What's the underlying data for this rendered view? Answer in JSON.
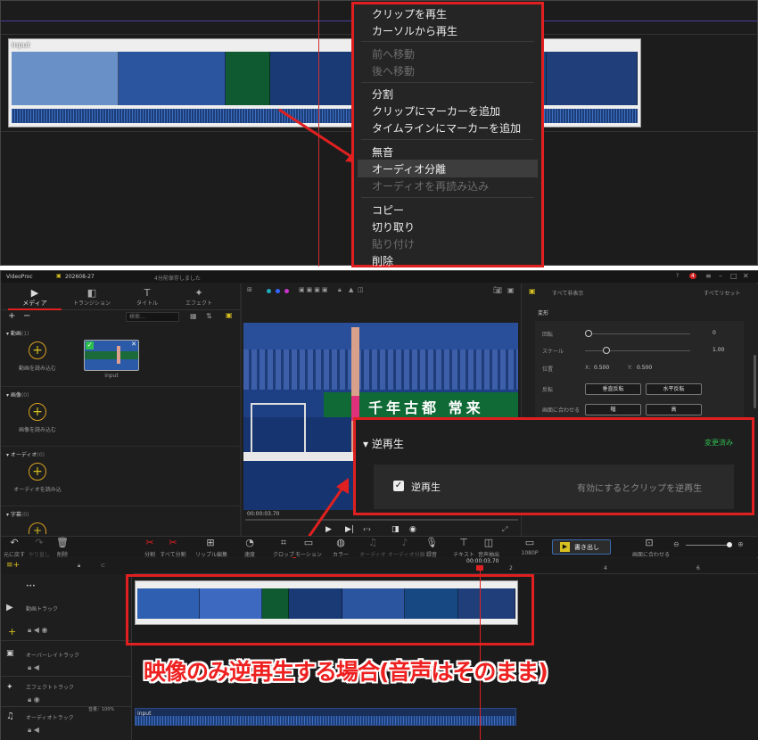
{
  "top_timeline": {
    "clip_label": "input"
  },
  "context_menu": {
    "items": [
      {
        "label": "クリップを再生",
        "disabled": false
      },
      {
        "label": "カーソルから再生",
        "disabled": false
      },
      {
        "label": "前へ移動",
        "disabled": true
      },
      {
        "label": "後へ移動",
        "disabled": true
      },
      {
        "label": "分割",
        "disabled": false
      },
      {
        "label": "クリップにマーカーを追加",
        "disabled": false
      },
      {
        "label": "タイムラインにマーカーを追加",
        "disabled": false
      },
      {
        "label": "無音",
        "disabled": false
      },
      {
        "label": "オーディオ分離",
        "disabled": false,
        "highlighted": true
      },
      {
        "label": "オーディオを再読み込み",
        "disabled": true
      },
      {
        "label": "コピー",
        "disabled": false
      },
      {
        "label": "切り取り",
        "disabled": false
      },
      {
        "label": "貼り付け",
        "disabled": true
      },
      {
        "label": "削除",
        "disabled": false
      }
    ]
  },
  "titlebar": {
    "app": "VideoProc",
    "project": "202608-27",
    "status": "4分前保存しました",
    "badge": "4"
  },
  "media_tabs": [
    "メディア",
    "トランジション",
    "タイトル",
    "エフェクト"
  ],
  "media_panel": {
    "search_placeholder": "検索...",
    "sections": [
      {
        "title": "動画",
        "count": "(1)",
        "hint": "動画を読み込む"
      },
      {
        "title": "画像",
        "count": "(0)",
        "hint": "画像を読み込む"
      },
      {
        "title": "オーディオ",
        "count": "(0)",
        "hint": "オーディオを読み込"
      },
      {
        "title": "字幕",
        "count": "(0)",
        "hint": ""
      }
    ],
    "thumb_label": "input"
  },
  "preview": {
    "timecode": "00:00:03.70",
    "banner": "千年古都 常来"
  },
  "right_panel": {
    "header": "すべて非表示",
    "reset": "すべてリセット",
    "section": "変形",
    "rows": {
      "rotate": "回転",
      "rotate_val": "0",
      "scale": "スケール",
      "scale_val": "1.00",
      "position": "位置",
      "pos_x_label": "X:",
      "pos_x": "0.500",
      "pos_y_label": "Y:",
      "pos_y": "0.500",
      "flip": "反転",
      "flip_v": "垂直反転",
      "flip_h": "水平反転",
      "fit": "画面に合わせる",
      "fit_w": "幅",
      "fit_h": "高"
    }
  },
  "reverse_box": {
    "title": "逆再生",
    "changed": "変更済み",
    "checkbox_label": "逆再生",
    "hint": "有効にするとクリップを逆再生",
    "checked": true
  },
  "toolbar": {
    "left": [
      "元に戻す",
      "やり直し",
      "削除"
    ],
    "center": [
      "分割",
      "すべて分割",
      "リップル編集",
      "速度",
      "クロップ",
      "モーション",
      "カラー",
      "オーディオ",
      "オーディオ分離",
      "録音",
      "テキスト",
      "音声抽出",
      "1080P"
    ],
    "export": "書き出し",
    "fit": "画面に合わせる"
  },
  "tracks": {
    "ruler_time": "00:00:03.70",
    "ruler_marks": [
      "2",
      "4",
      "6"
    ],
    "video": "動画トラック",
    "overlay": "オーバーレイトラック",
    "effect": "エフェクトトラック",
    "audio": "オーディオトラック",
    "volume": "音量：100%",
    "audio_clip": "input",
    "more": "•••"
  },
  "caption": "映像のみ逆再生する場合(音声はそのまま)",
  "colors": {
    "highlight": "#e02020",
    "accent": "#d8c020",
    "green": "#2fbf4f",
    "panel": "#1e1e1e"
  }
}
